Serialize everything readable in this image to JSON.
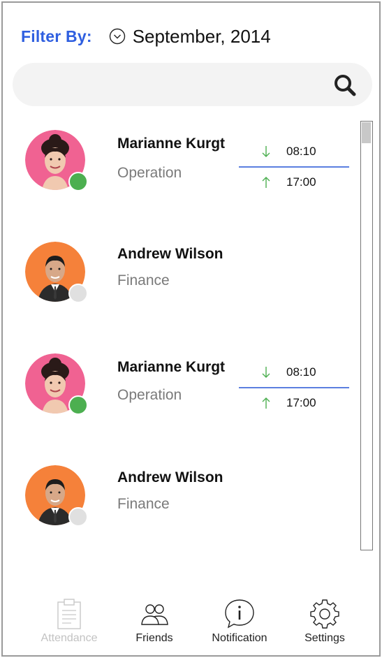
{
  "filter": {
    "label": "Filter By:",
    "month": "September, 2014"
  },
  "search": {
    "placeholder": "",
    "icon": "search-icon"
  },
  "employees": [
    {
      "name": "Marianne Kurgt",
      "department": "Operation",
      "status": "online",
      "status_color": "#4caf50",
      "avatar_bg": "#f06292",
      "time_in": "08:10",
      "time_out": "17:00"
    },
    {
      "name": "Andrew Wilson",
      "department": "Finance",
      "status": "offline",
      "status_color": "#e0e0e0",
      "avatar_bg": "#f5813a"
    },
    {
      "name": "Marianne Kurgt",
      "department": "Operation",
      "status": "online",
      "status_color": "#4caf50",
      "avatar_bg": "#f06292",
      "time_in": "08:10",
      "time_out": "17:00"
    },
    {
      "name": "Andrew Wilson",
      "department": "Finance",
      "status": "offline",
      "status_color": "#e0e0e0",
      "avatar_bg": "#f5813a"
    }
  ],
  "nav": {
    "attendance": "Attendance",
    "friends": "Friends",
    "notification": "Notification",
    "settings": "Settings"
  },
  "colors": {
    "accent": "#2f5fe0",
    "divider": "#5b7fe0",
    "arrow": "#4caf50",
    "muted_text": "#7a7a7a",
    "disabled_nav": "#c2c2c2"
  }
}
